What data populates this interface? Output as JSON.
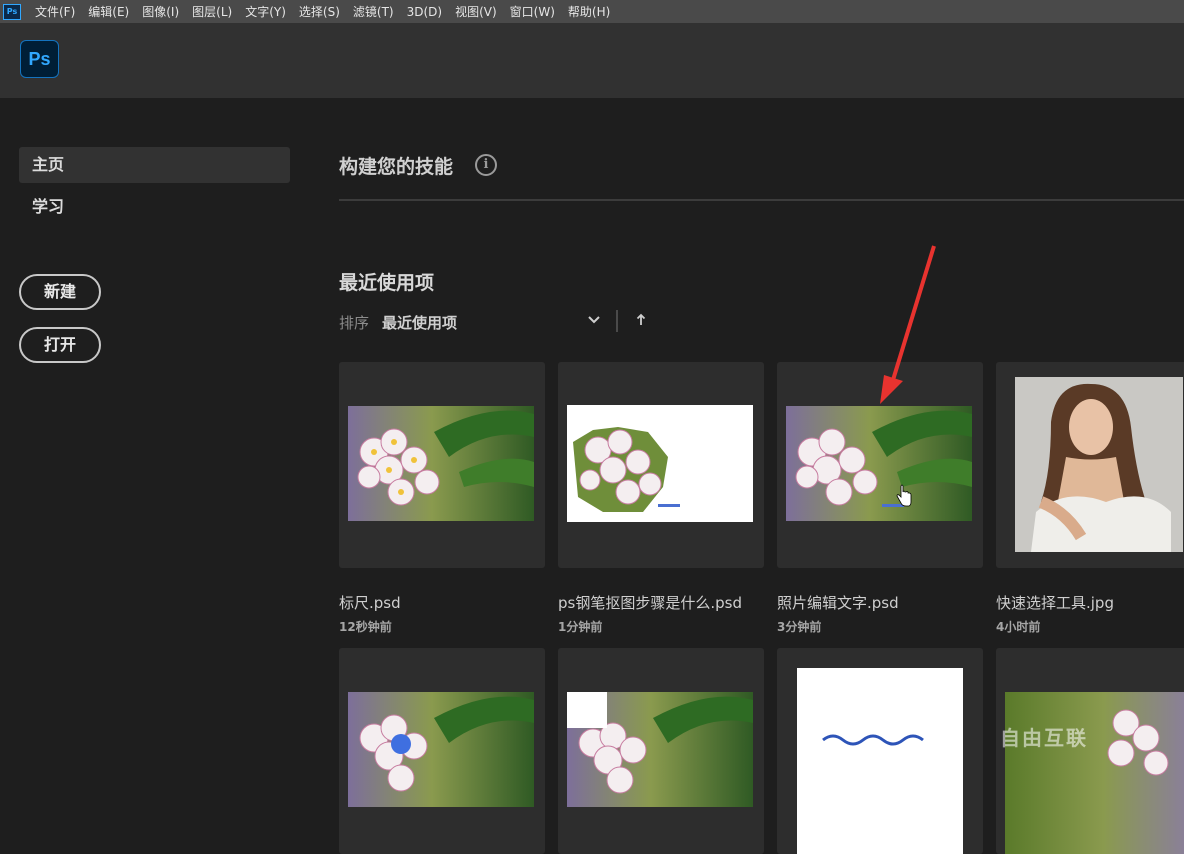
{
  "menubar": {
    "app_icon": "ps-small-icon",
    "items": [
      "文件(F)",
      "编辑(E)",
      "图像(I)",
      "图层(L)",
      "文字(Y)",
      "选择(S)",
      "滤镜(T)",
      "3D(D)",
      "视图(V)",
      "窗口(W)",
      "帮助(H)"
    ]
  },
  "header": {
    "logo_text": "Ps"
  },
  "sidebar": {
    "nav": [
      {
        "label": "主页",
        "active": true
      },
      {
        "label": "学习",
        "active": false
      }
    ],
    "new_button": "新建",
    "open_button": "打开"
  },
  "main": {
    "skills_title": "构建您的技能",
    "info_icon_glyph": "i",
    "recent_title": "最近使用项",
    "sort_label": "排序",
    "sort_value": "最近使用项"
  },
  "recent_files": [
    {
      "name": "标尺.psd",
      "time": "12秒钟前",
      "thumb": "flower"
    },
    {
      "name": "ps钢笔抠图步骤是什么.psd",
      "time": "1分钟前",
      "thumb": "cutout"
    },
    {
      "name": "照片编辑文字.psd",
      "time": "3分钟前",
      "thumb": "flower-text"
    },
    {
      "name": "快速选择工具.jpg",
      "time": "4小时前",
      "thumb": "portrait"
    }
  ],
  "recent_files_row2": [
    {
      "thumb": "flower-dot"
    },
    {
      "thumb": "flower-square"
    },
    {
      "thumb": "wave"
    },
    {
      "thumb": "flower-right"
    }
  ],
  "watermark": "自由互联",
  "colors": {
    "ps_blue": "#31a8ff",
    "arrow_red": "#e8332f",
    "background": "#1e1e1e",
    "card": "#2d2d2d"
  }
}
